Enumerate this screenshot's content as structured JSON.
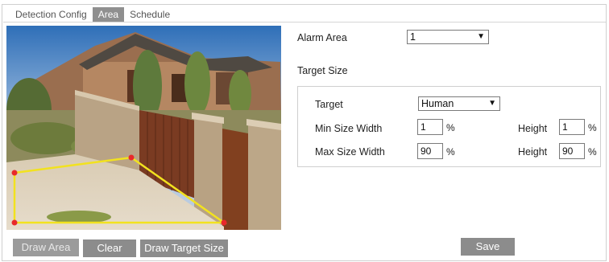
{
  "tabs": [
    {
      "label": "Detection Config",
      "active": false
    },
    {
      "label": "Area",
      "active": true
    },
    {
      "label": "Schedule",
      "active": false
    }
  ],
  "preview": {
    "area_color": "#f2e21f",
    "vertex_color": "#e8292b"
  },
  "buttons": {
    "draw_area": "Draw Area",
    "clear": "Clear",
    "draw_target_size": "Draw Target Size",
    "save": "Save"
  },
  "form": {
    "alarm_area_label": "Alarm Area",
    "alarm_area_value": "1",
    "target_size_heading": "Target Size",
    "target_label": "Target",
    "target_value": "Human",
    "min_width_label": "Min Size Width",
    "min_width_value": "1",
    "min_height_label": "Height",
    "min_height_value": "1",
    "max_width_label": "Max Size Width",
    "max_width_value": "90",
    "max_height_label": "Height",
    "max_height_value": "90",
    "unit": "%"
  },
  "icons": {
    "dropdown": "chevron-down-icon"
  }
}
